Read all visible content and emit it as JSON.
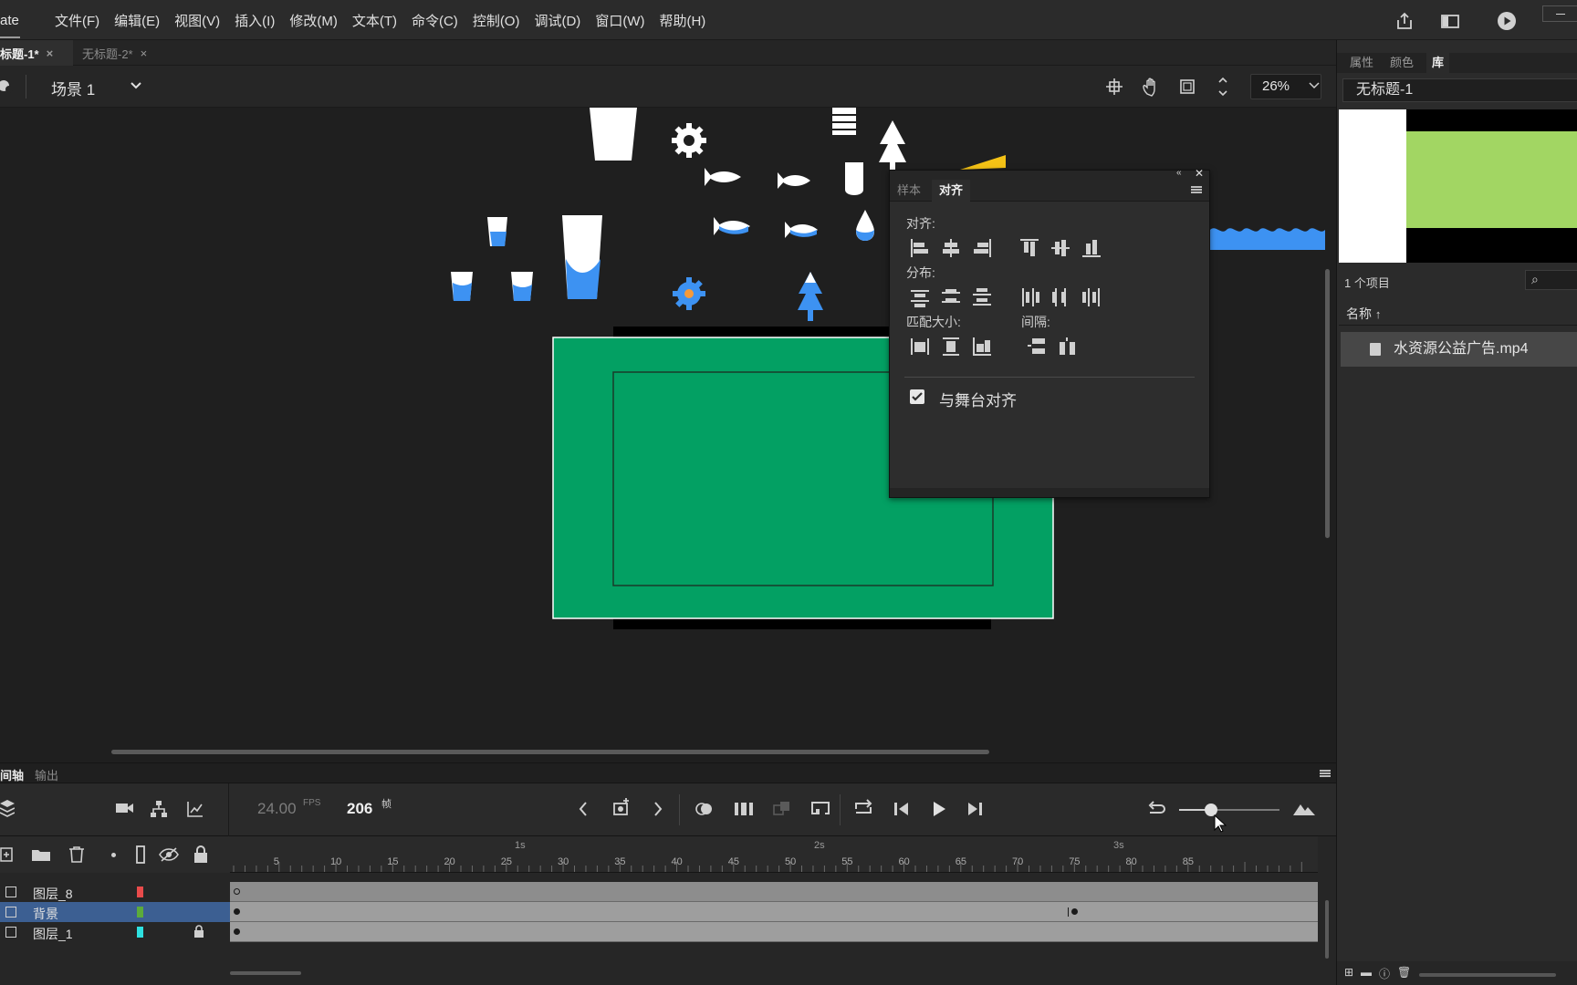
{
  "app": {
    "title_fragment": "ate",
    "menu": [
      "文件(F)",
      "编辑(E)",
      "视图(V)",
      "插入(I)",
      "修改(M)",
      "文本(T)",
      "命令(C)",
      "控制(O)",
      "调试(D)",
      "窗口(W)",
      "帮助(H)"
    ]
  },
  "doc_tabs": [
    {
      "label": "标题-1*",
      "active": true
    },
    {
      "label": "无标题-2*",
      "active": false
    }
  ],
  "editbar": {
    "scene": "场景 1",
    "zoom": "26%"
  },
  "align_panel": {
    "tabs": [
      "样本",
      "对齐"
    ],
    "active_tab": "对齐",
    "sections": {
      "align": "对齐:",
      "distribute": "分布:",
      "match_size": "匹配大小:",
      "spacing": "间隔:"
    },
    "align_to_stage": {
      "label": "与舞台对齐",
      "checked": true
    }
  },
  "right_panel": {
    "tabs": [
      "属性",
      "颜色",
      "库"
    ],
    "active_tab": "库",
    "document": "无标题-1",
    "item_count": "1 个项目",
    "column_name": "名称",
    "items": [
      {
        "name": "水资源公益广告.mp4"
      }
    ]
  },
  "timeline": {
    "tabs": [
      "间轴",
      "输出"
    ],
    "fps": "24.00",
    "fps_unit": "FPS",
    "frame": "206",
    "frame_unit": "帧",
    "seconds_labels": [
      "1s",
      "2s",
      "3s"
    ],
    "frame_numbers": [
      "5",
      "10",
      "15",
      "20",
      "25",
      "30",
      "35",
      "40",
      "45",
      "50",
      "55",
      "60",
      "65",
      "70",
      "75",
      "80",
      "85"
    ],
    "layers": [
      {
        "name": "图层_8",
        "color": "#e84b4b",
        "locked": false,
        "selected": false
      },
      {
        "name": "背景",
        "color": "#5cab3a",
        "locked": false,
        "selected": true
      },
      {
        "name": "图层_1",
        "color": "#2ee0e0",
        "locked": true,
        "selected": false
      }
    ]
  },
  "colors": {
    "stage_green": "#03a063",
    "water_blue": "#3d92f2",
    "preview_green": "#a2d663",
    "selection_blue": "#3c5f92"
  }
}
